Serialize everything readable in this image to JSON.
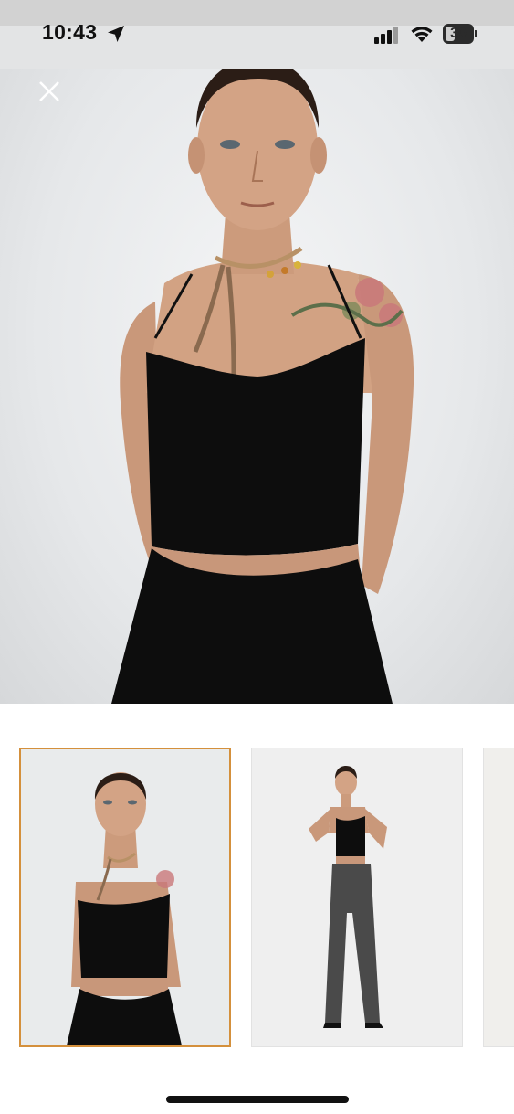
{
  "status_bar": {
    "time": "10:43",
    "battery_level": "30",
    "icons": [
      "location-arrow-icon",
      "cellular-signal-icon",
      "wifi-icon",
      "battery-icon"
    ]
  },
  "viewer": {
    "close_icon": "close-icon",
    "selected_index": 0
  },
  "thumbnails": [
    {
      "id": "thumb-1",
      "content": "model-halter-top-closeup",
      "selected": true
    },
    {
      "id": "thumb-2",
      "content": "model-full-body-outfit",
      "selected": false
    },
    {
      "id": "thumb-3",
      "content": "partial-next-image",
      "selected": false
    }
  ],
  "colors": {
    "selected_border": "#d4903c",
    "garment": "#0d0d0d",
    "background": "#ffffff"
  }
}
